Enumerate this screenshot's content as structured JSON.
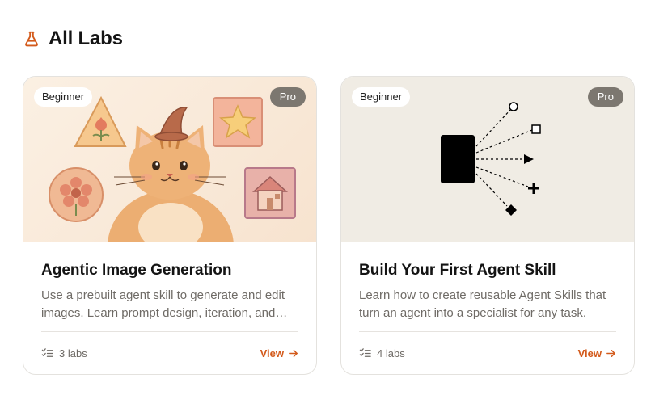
{
  "page": {
    "title": "All Labs",
    "accent": "#d35a1b"
  },
  "cards": [
    {
      "level": "Beginner",
      "tier": "Pro",
      "title": "Agentic Image Generation",
      "description": "Use a prebuilt agent skill to generate and edit images. Learn prompt design, iteration, and image editing techniques.",
      "labs": "3 labs",
      "cta": "View"
    },
    {
      "level": "Beginner",
      "tier": "Pro",
      "title": "Build Your First Agent Skill",
      "description": "Learn how to create reusable Agent Skills that turn an agent into a specialist for any task.",
      "labs": "4 labs",
      "cta": "View"
    }
  ],
  "icons": {
    "header": "flask-icon",
    "labs": "checklist-icon",
    "cta": "arrow-right-icon"
  }
}
